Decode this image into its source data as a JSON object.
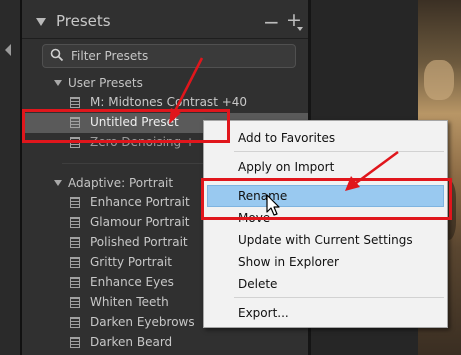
{
  "panel": {
    "title": "Presets",
    "minus_symbol": "−",
    "plus_symbol": "+",
    "filter_placeholder": "Filter Presets"
  },
  "groups": [
    {
      "label": "User Presets",
      "items": [
        {
          "label": "M: Midtones Contrast +40",
          "state": "normal"
        },
        {
          "label": "Untitled Preset",
          "state": "selected"
        },
        {
          "label": "Zero Denoising +",
          "state": "dim"
        }
      ]
    },
    {
      "label": "Adaptive: Portrait",
      "items": [
        {
          "label": "Enhance Portrait"
        },
        {
          "label": "Glamour Portrait"
        },
        {
          "label": "Polished Portrait"
        },
        {
          "label": "Gritty Portrait"
        },
        {
          "label": "Enhance Eyes"
        },
        {
          "label": "Whiten Teeth"
        },
        {
          "label": "Darken Eyebrows"
        },
        {
          "label": "Darken Beard"
        }
      ]
    }
  ],
  "context_menu": {
    "items": [
      {
        "label": "Add to Favorites"
      },
      {
        "label": "Apply on Import"
      },
      {
        "label": "Rename",
        "highlighted": true
      },
      {
        "label": "Move"
      },
      {
        "label": "Update with Current Settings"
      },
      {
        "label": "Show in Explorer"
      },
      {
        "label": "Delete"
      },
      {
        "label": "Export..."
      }
    ]
  },
  "annotation_color": "#e0161c",
  "menu_highlight_color": "#99c9f0",
  "icons": [
    "collapse-left-icon",
    "disclosure-triangle-icon",
    "search-icon",
    "preset-icon",
    "mouse-cursor-icon"
  ]
}
